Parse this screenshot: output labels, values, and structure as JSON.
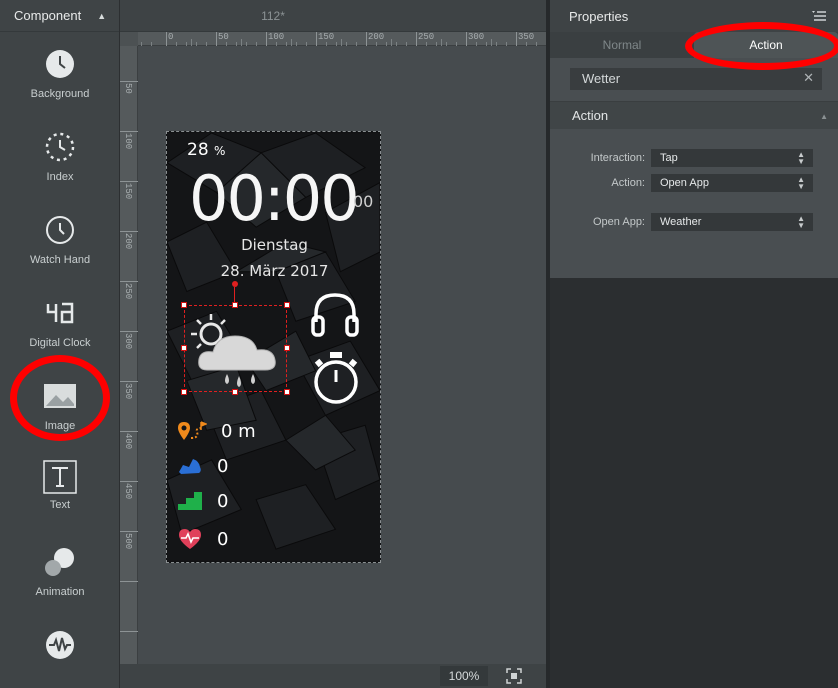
{
  "left_panel": {
    "title": "Component",
    "items": [
      {
        "label": "Background",
        "icon": "clock-icon"
      },
      {
        "label": "Index",
        "icon": "dashed-clock-icon"
      },
      {
        "label": "Watch Hand",
        "icon": "watch-hand-icon"
      },
      {
        "label": "Digital Clock",
        "icon": "digital-clock-icon"
      },
      {
        "label": "Image",
        "icon": "image-icon"
      },
      {
        "label": "Text",
        "icon": "text-icon"
      },
      {
        "label": "Animation",
        "icon": "animation-icon"
      },
      {
        "label": "",
        "icon": "waveform-icon"
      }
    ]
  },
  "canvas": {
    "title": "112*",
    "zoom": "100%",
    "ruler_top": [
      "0",
      "50",
      "100",
      "150",
      "200",
      "250",
      "300",
      "350"
    ],
    "ruler_left": [
      "50",
      "100",
      "150",
      "200",
      "250",
      "300",
      "350",
      "400",
      "450",
      "500"
    ]
  },
  "watch": {
    "battery_value": "28",
    "battery_unit": "%",
    "time": "00:00",
    "seconds": "00",
    "day": "Dienstag",
    "date": "28. März 2017",
    "distance": "0 m",
    "steps": "0",
    "floors": "0",
    "heart_rate": "0"
  },
  "properties": {
    "title": "Properties",
    "tabs": [
      "Normal",
      "Action"
    ],
    "active_tab": "Action",
    "name_value": "Wetter",
    "section_title": "Action",
    "interaction_label": "Interaction:",
    "interaction_value": "Tap",
    "action_label": "Action:",
    "action_value": "Open App",
    "open_app_label": "Open App:",
    "open_app_value": "Weather"
  },
  "colors": {
    "highlight_ring": "#ff0000",
    "selection": "#e02020",
    "panel": "#3f4446",
    "marker_orange": "#f08a1c",
    "shoe_blue": "#2a6fd6",
    "stairs_green": "#1fb04a",
    "heart_red": "#e0405a"
  }
}
